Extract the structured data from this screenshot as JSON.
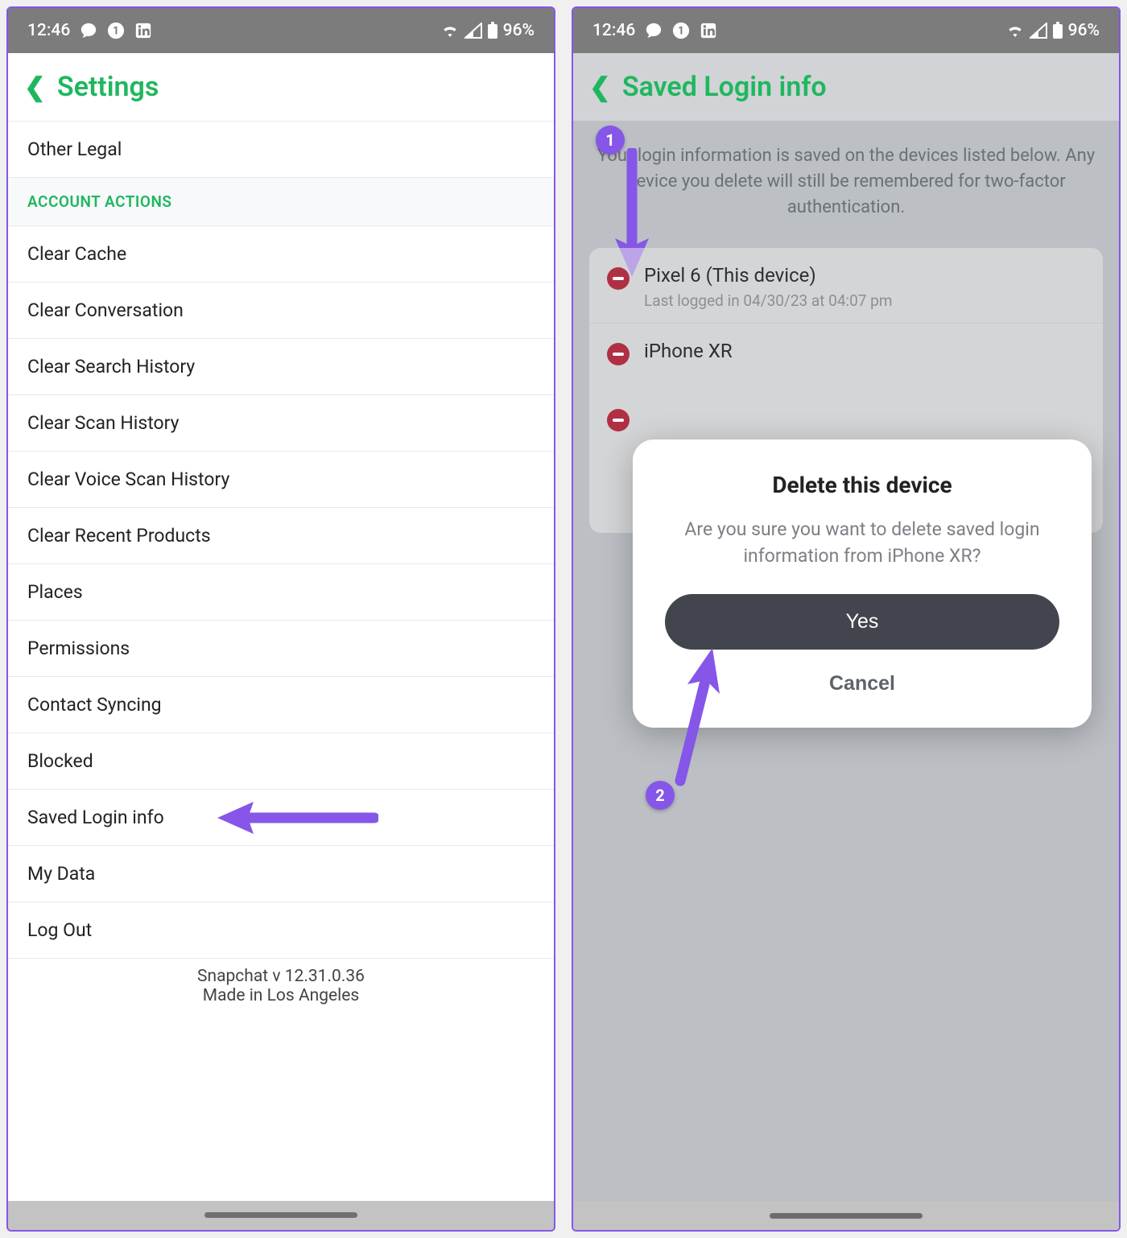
{
  "status": {
    "time": "12:46",
    "battery": "96%"
  },
  "left": {
    "title": "Settings",
    "rows": {
      "other_legal": "Other Legal",
      "section": "ACCOUNT ACTIONS",
      "clear_cache": "Clear Cache",
      "clear_conversation": "Clear Conversation",
      "clear_search": "Clear Search History",
      "clear_scan": "Clear Scan History",
      "clear_voice_scan": "Clear Voice Scan History",
      "clear_recent_products": "Clear Recent Products",
      "places": "Places",
      "permissions": "Permissions",
      "contact_syncing": "Contact Syncing",
      "blocked": "Blocked",
      "saved_login": "Saved Login info",
      "my_data": "My Data",
      "log_out": "Log Out"
    },
    "footer": {
      "version": "Snapchat v 12.31.0.36",
      "made": "Made in Los Angeles"
    }
  },
  "right": {
    "title": "Saved Login info",
    "intro": "Your login information is saved on the devices listed below. Any device you delete will still be remembered for two-factor authentication.",
    "badge1": "1",
    "badge2": "2",
    "devices": {
      "d1_name": "Pixel 6 (This device)",
      "d1_sub": "Last logged in 04/30/23 at 04:07 pm",
      "d2_name": "iPhone XR"
    },
    "modal": {
      "title": "Delete this device",
      "body": "Are you sure you want to delete saved login information from iPhone XR?",
      "yes": "Yes",
      "cancel": "Cancel"
    }
  }
}
